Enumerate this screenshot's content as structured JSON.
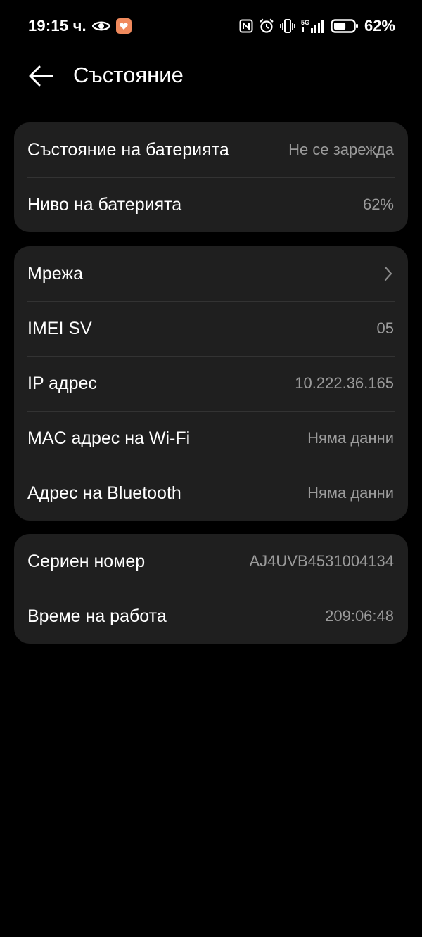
{
  "status_bar": {
    "time": "19:15 ч.",
    "battery_percent": "62%",
    "battery_level": 0.62,
    "network_label": "5G",
    "icons": [
      "eye-icon",
      "app-notification-icon",
      "nfc-icon",
      "alarm-icon",
      "vibrate-icon",
      "signal-icon",
      "battery-icon"
    ]
  },
  "header": {
    "title": "Състояние",
    "back_icon": "arrow-left-icon"
  },
  "battery_card": [
    {
      "label": "Състояние на батерията",
      "value": "Не се зарежда"
    },
    {
      "label": "Ниво на батерията",
      "value": "62%"
    }
  ],
  "network_card": [
    {
      "label": "Мрежа",
      "value": "",
      "icon": "chevron-right-icon"
    },
    {
      "label": "IMEI SV",
      "value": "05"
    },
    {
      "label": "IP адрес",
      "value": "10.222.36.165"
    },
    {
      "label": "MAC адрес на Wi-Fi",
      "value": "Няма данни"
    },
    {
      "label": "Адрес на Bluetooth",
      "value": "Няма данни"
    }
  ],
  "device_card": [
    {
      "label": "Сериен номер",
      "value": "AJ4UVB4531004134"
    },
    {
      "label": "Време на работа",
      "value": "209:06:48"
    }
  ],
  "colors": {
    "background": "#000000",
    "card": "#1f1f1f",
    "divider": "#333333",
    "secondary_text": "#9b9b9b",
    "app_badge": "#f08a5d"
  }
}
